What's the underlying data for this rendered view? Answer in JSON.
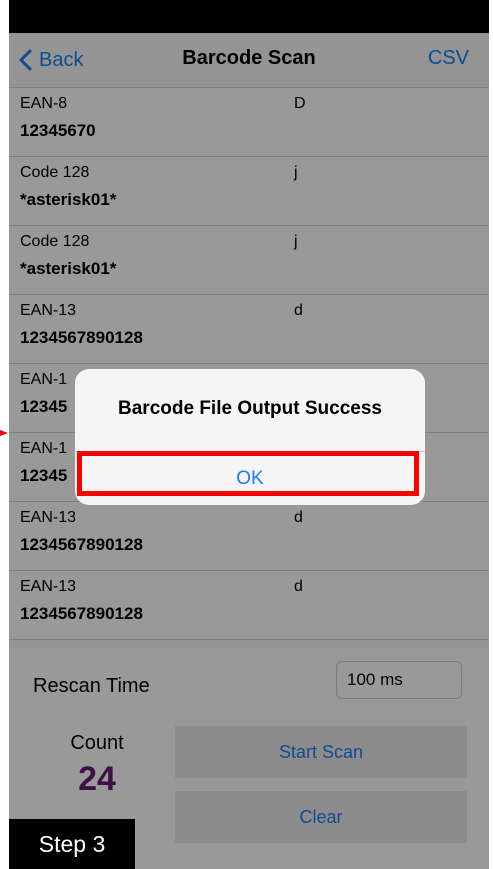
{
  "nav": {
    "back_label": "Back",
    "title": "Barcode Scan",
    "csv_label": "CSV"
  },
  "rows": [
    {
      "type": "EAN-8",
      "code": "12345670",
      "tag": "D"
    },
    {
      "type": "Code 128",
      "code": "*asterisk01*",
      "tag": "j"
    },
    {
      "type": "Code 128",
      "code": "*asterisk01*",
      "tag": "j"
    },
    {
      "type": "EAN-13",
      "code": "1234567890128",
      "tag": "d"
    },
    {
      "type": "EAN-1",
      "code": "12345",
      "tag": ""
    },
    {
      "type": "EAN-1",
      "code": "12345",
      "tag": ""
    },
    {
      "type": "EAN-13",
      "code": "1234567890128",
      "tag": "d"
    },
    {
      "type": "EAN-13",
      "code": "1234567890128",
      "tag": "d"
    }
  ],
  "controls": {
    "rescan_label": "Rescan Time",
    "rescan_value": "100 ms",
    "count_label": "Count",
    "count_value": "24",
    "start_label": "Start Scan",
    "clear_label": "Clear"
  },
  "alert": {
    "title": "Barcode File Output Success",
    "ok_label": "OK"
  },
  "step_badge": "Step 3",
  "colors": {
    "accent": "#1a7df2",
    "count": "#6a1a78",
    "highlight": "#ff0000"
  }
}
